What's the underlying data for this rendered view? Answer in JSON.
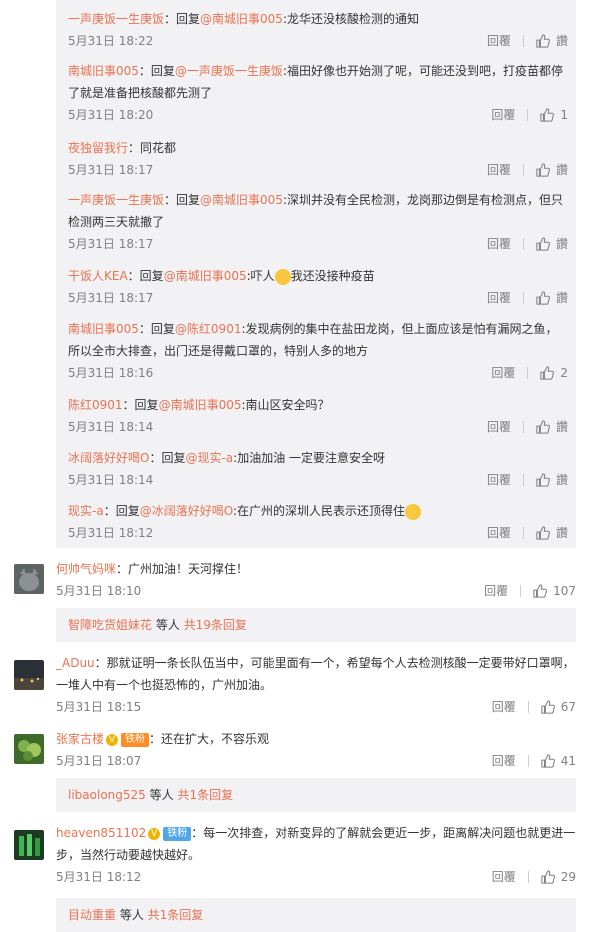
{
  "actions": {
    "reply_label": "回覆",
    "like_label": "讚"
  },
  "nested": [
    {
      "user": "一声庚饭一生庚饭",
      "prefix": "：回复",
      "mention": "@南城旧事005",
      "text": ":龙华还没核酸检测的通知",
      "time": "5月31日 18:22",
      "likes": "讚"
    },
    {
      "user": "南城旧事005",
      "prefix": "：回复",
      "mention": "@一声庚饭一生庚饭",
      "text": ":福田好像也开始测了呢，可能还没到吧，打疫苗都停了就是准备把核酸都先测了",
      "time": "5月31日 18:20",
      "likes": "1"
    },
    {
      "user": "夜独留我行",
      "prefix": "：同花都",
      "mention": "",
      "text": "",
      "time": "5月31日 18:17",
      "likes": "讚"
    },
    {
      "user": "一声庚饭一生庚饭",
      "prefix": "：回复",
      "mention": "@南城旧事005",
      "text": ":深圳并没有全民检测，龙岗那边倒是有检测点，但只检测两三天就撤了",
      "time": "5月31日 18:17",
      "likes": "讚"
    },
    {
      "user": "干饭人KEA",
      "prefix": "：回复",
      "mention": "@南城旧事005",
      "text": ":吓人",
      "text2": "我还没接种疫苗",
      "time": "5月31日 18:17",
      "likes": "讚"
    },
    {
      "user": "南城旧事005",
      "prefix": "：回复",
      "mention": "@陈红0901",
      "text": ":发现病例的集中在盐田龙岗，但上面应该是怕有漏网之鱼，所以全市大排查，出门还是得戴口罩的，特别人多的地方",
      "time": "5月31日 18:16",
      "likes": "2"
    },
    {
      "user": "陈红0901",
      "prefix": "：回复",
      "mention": "@南城旧事005",
      "text": ":南山区安全吗？",
      "time": "5月31日 18:14",
      "likes": "讚"
    },
    {
      "user": "冰阔落好好喝O",
      "prefix": "：回复",
      "mention": "@现实-a",
      "text": ":加油加油 一定要注意安全呀",
      "time": "5月31日 18:14",
      "likes": "讚"
    },
    {
      "user": "现实-a",
      "prefix": "：回复",
      "mention": "@冰阔落好好喝O",
      "text": ":在广州的深圳人民表示还顶得住",
      "time": "5月31日 18:12",
      "likes": "讚"
    }
  ],
  "top": [
    {
      "user": "何帅气妈咪",
      "text": "：广州加油！天河撑住！",
      "time": "5月31日 18:10",
      "likes": "107",
      "more": {
        "users": "智障吃货姐妹花",
        "suffix": " 等人 ",
        "count": "共19条回复"
      }
    },
    {
      "user": "_ADuu",
      "text": "：那就证明一条长队伍当中，可能里面有一个，希望每个人去检测核酸一定要带好口罩啊，一堆人中有一个也挺恐怖的，广州加油。",
      "time": "5月31日 18:15",
      "likes": "67"
    },
    {
      "user": "张家古楼",
      "badge": "铁粉",
      "text": "：还在扩大，不容乐观",
      "time": "5月31日 18:07",
      "likes": "41",
      "more": {
        "users": "libaolong525",
        "suffix": " 等人 ",
        "count": "共1条回复"
      }
    },
    {
      "user": "heaven851102",
      "badge": "铁粉",
      "text": "：每一次排查，对新变异的了解就会更近一步，距离解决问题也就更进一步，当然行动要越快越好。",
      "time": "5月31日 18:12",
      "likes": "29",
      "more": {
        "users": "目动重重",
        "suffix": " 等人 ",
        "count": "共1条回复"
      }
    }
  ]
}
